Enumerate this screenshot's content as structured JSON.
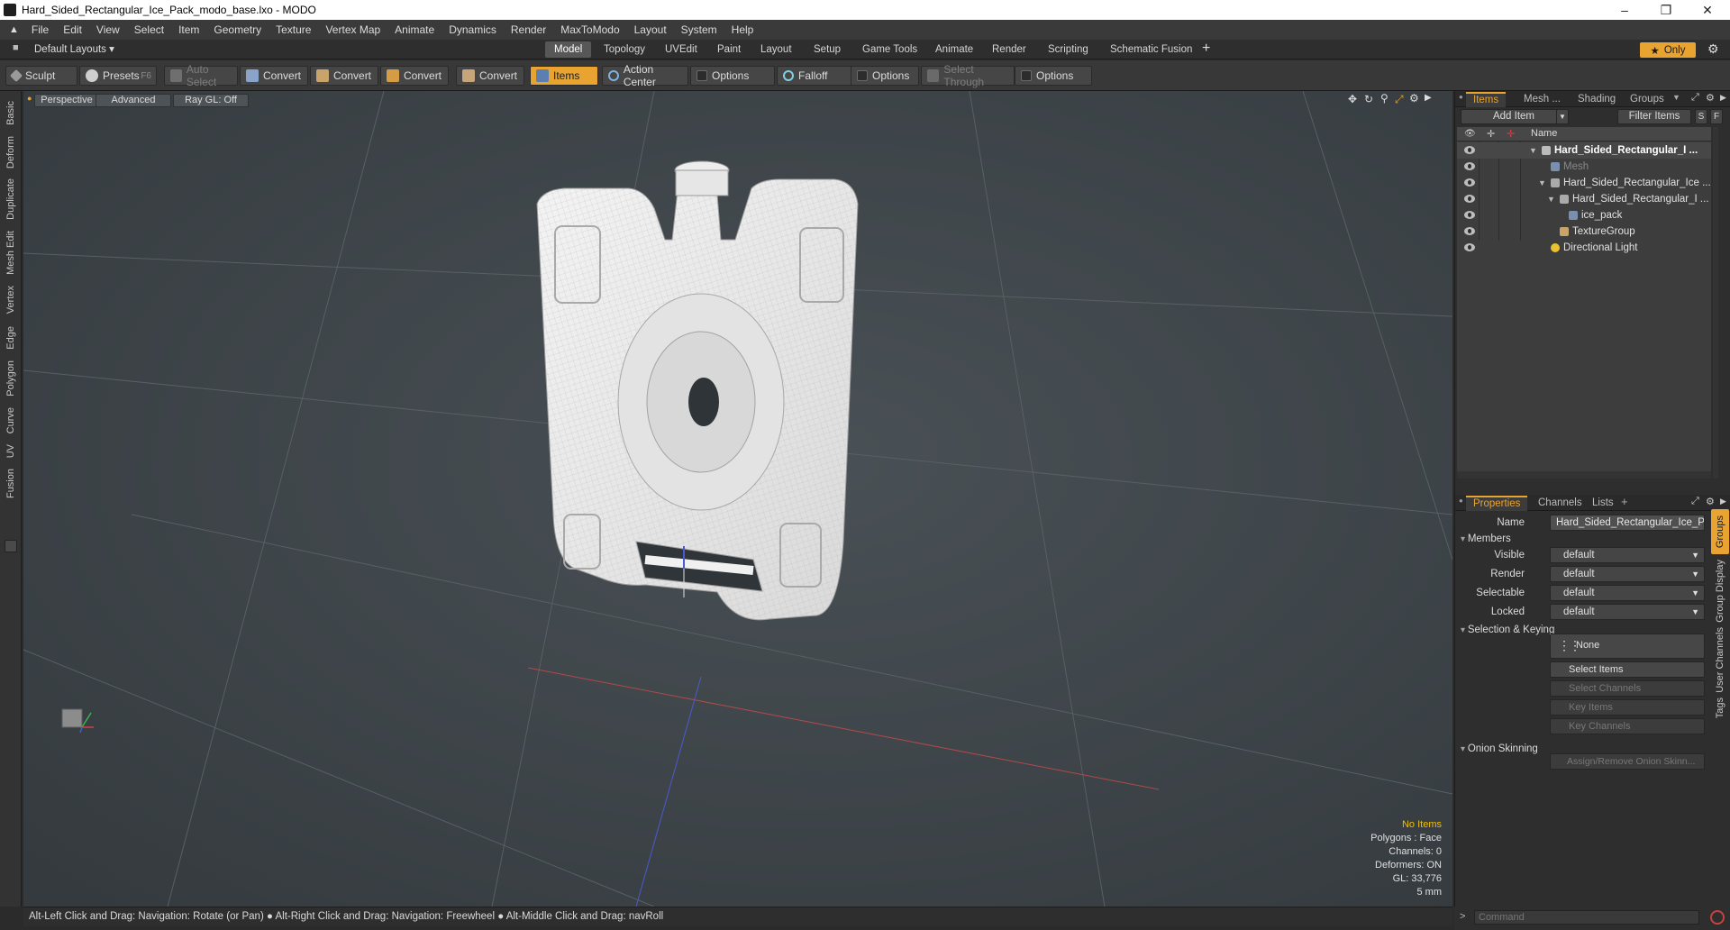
{
  "window": {
    "title": "Hard_Sided_Rectangular_Ice_Pack_modo_base.lxo - MODO"
  },
  "menu": [
    "File",
    "Edit",
    "View",
    "Select",
    "Item",
    "Geometry",
    "Texture",
    "Vertex Map",
    "Animate",
    "Dynamics",
    "Render",
    "MaxToModo",
    "Layout",
    "System",
    "Help"
  ],
  "layout_selector": "Default Layouts ▾",
  "layout_tabs": [
    "Model",
    "Topology",
    "UVEdit",
    "Paint",
    "Layout",
    "Setup",
    "Game Tools",
    "Animate",
    "Render",
    "Scripting",
    "Schematic Fusion"
  ],
  "only_label": "Only",
  "toolbar": {
    "sculpt": "Sculpt",
    "presets": "Presets",
    "presets_key": "F6",
    "auto_select": "Auto Select",
    "convert1": "Convert",
    "convert2": "Convert",
    "convert3": "Convert",
    "convert4": "Convert",
    "items": "Items",
    "action_center": "Action Center",
    "options1": "Options",
    "falloff": "Falloff",
    "options2": "Options",
    "select_through": "Select Through",
    "options3": "Options"
  },
  "left_tabs": [
    "Basic",
    "Deform",
    "Duplicate",
    "Mesh Edit",
    "Vertex",
    "Edge",
    "Polygon",
    "Curve",
    "UV",
    "Fusion"
  ],
  "viewport": {
    "view_mode": "Perspective",
    "shading": "Advanced",
    "raygl": "Ray GL: Off",
    "stats": {
      "no_items": "No Items",
      "polygons": "Polygons : Face",
      "channels": "Channels: 0",
      "deformers": "Deformers: ON",
      "gl": "GL: 33,776",
      "scale": "5 mm"
    }
  },
  "status_bar": "Alt-Left Click and Drag: Navigation: Rotate (or Pan) ● Alt-Right Click and Drag: Navigation: Freewheel ● Alt-Middle Click and Drag: navRoll",
  "items_panel": {
    "tabs": [
      "Items",
      "Mesh ...",
      "Shading",
      "Groups"
    ],
    "add_item": "Add Item",
    "filter_items": "Filter Items",
    "s_btn": "S",
    "f_btn": "F",
    "col_name": "Name",
    "tree": [
      {
        "label": "Hard_Sided_Rectangular_I ...",
        "bold": true
      },
      {
        "label": "Mesh",
        "dim": true
      },
      {
        "label": "Hard_Sided_Rectangular_Ice ..."
      },
      {
        "label": "Hard_Sided_Rectangular_I ..."
      },
      {
        "label": "ice_pack"
      },
      {
        "label": "TextureGroup"
      },
      {
        "label": "Directional Light"
      }
    ]
  },
  "properties_panel": {
    "tabs": [
      "Properties",
      "Channels",
      "Lists"
    ],
    "name_label": "Name",
    "name_value": "Hard_Sided_Rectangular_Ice_Pa",
    "members": "Members",
    "visible_label": "Visible",
    "visible_value": "default",
    "render_label": "Render",
    "render_value": "default",
    "selectable_label": "Selectable",
    "selectable_value": "default",
    "locked_label": "Locked",
    "locked_value": "default",
    "selection_keying": "Selection & Keying",
    "none_label": "None",
    "select_items": "Select Items",
    "select_channels": "Select Channels",
    "key_items": "Key Items",
    "key_channels": "Key Channels",
    "onion_skinning": "Onion Skinning",
    "assign_remove": "Assign/Remove Onion Skinn...",
    "side_tabs": [
      "Groups",
      "Group Display",
      "User Channels",
      "Tags"
    ]
  },
  "command": {
    "placeholder": "Command"
  }
}
